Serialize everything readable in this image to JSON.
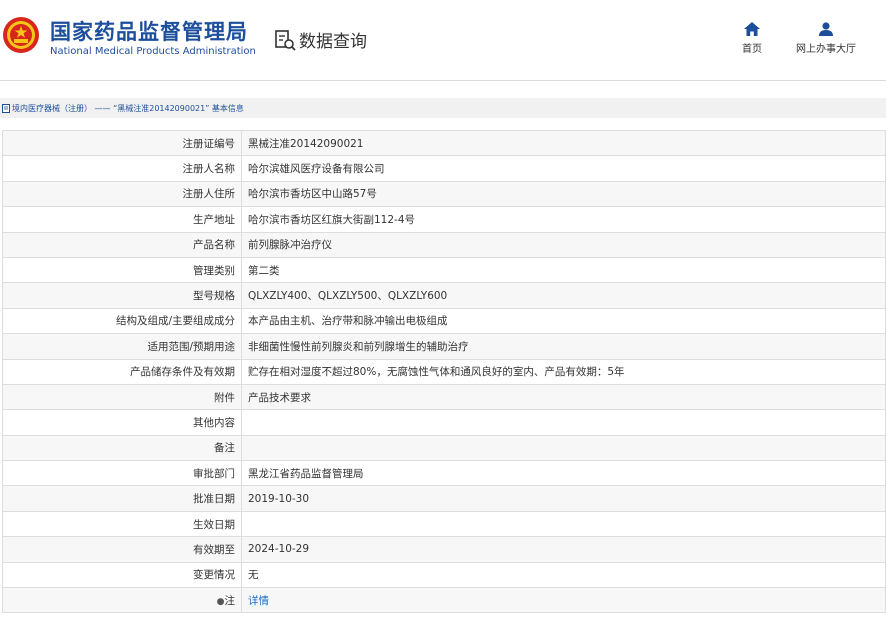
{
  "header": {
    "title_cn": "国家药品监督管理局",
    "title_en": "National Medical Products Administration",
    "query_label": "数据查询",
    "nav": [
      {
        "label": "首页",
        "icon": "home-icon"
      },
      {
        "label": "网上办事大厅",
        "icon": "user-icon"
      }
    ]
  },
  "breadcrumb": {
    "text": "境内医疗器械（注册） —— “黑械注准20142090021” 基本信息"
  },
  "detail": {
    "rows": [
      {
        "label": "注册证编号",
        "value": "黑械注准20142090021"
      },
      {
        "label": "注册人名称",
        "value": "哈尔滨雄风医疗设备有限公司"
      },
      {
        "label": "注册人住所",
        "value": "哈尔滨市香坊区中山路57号"
      },
      {
        "label": "生产地址",
        "value": "哈尔滨市香坊区红旗大街副112-4号"
      },
      {
        "label": "产品名称",
        "value": "前列腺脉冲治疗仪"
      },
      {
        "label": "管理类别",
        "value": "第二类"
      },
      {
        "label": "型号规格",
        "value": "QLXZLY400、QLXZLY500、QLXZLY600"
      },
      {
        "label": "结构及组成/主要组成成分",
        "value": "本产品由主机、治疗带和脉冲输出电极组成"
      },
      {
        "label": "适用范围/预期用途",
        "value": "非细菌性慢性前列腺炎和前列腺增生的辅助治疗"
      },
      {
        "label": "产品储存条件及有效期",
        "value": "贮存在相对湿度不超过80%，无腐蚀性气体和通风良好的室内、产品有效期：5年"
      },
      {
        "label": "附件",
        "value": "产品技术要求"
      },
      {
        "label": "其他内容",
        "value": ""
      },
      {
        "label": "备注",
        "value": ""
      },
      {
        "label": "审批部门",
        "value": "黑龙江省药品监督管理局"
      },
      {
        "label": "批准日期",
        "value": "2019-10-30"
      },
      {
        "label": "生效日期",
        "value": ""
      },
      {
        "label": "有效期至",
        "value": "2024-10-29"
      },
      {
        "label": "变更情况",
        "value": "无"
      }
    ],
    "note": {
      "label": "注",
      "link_text": "详情"
    }
  },
  "colors": {
    "brand_blue": "#1d4e9c",
    "link_blue": "#1a6fc2",
    "emblem_red": "#d8261c",
    "emblem_gold": "#f5c518"
  }
}
